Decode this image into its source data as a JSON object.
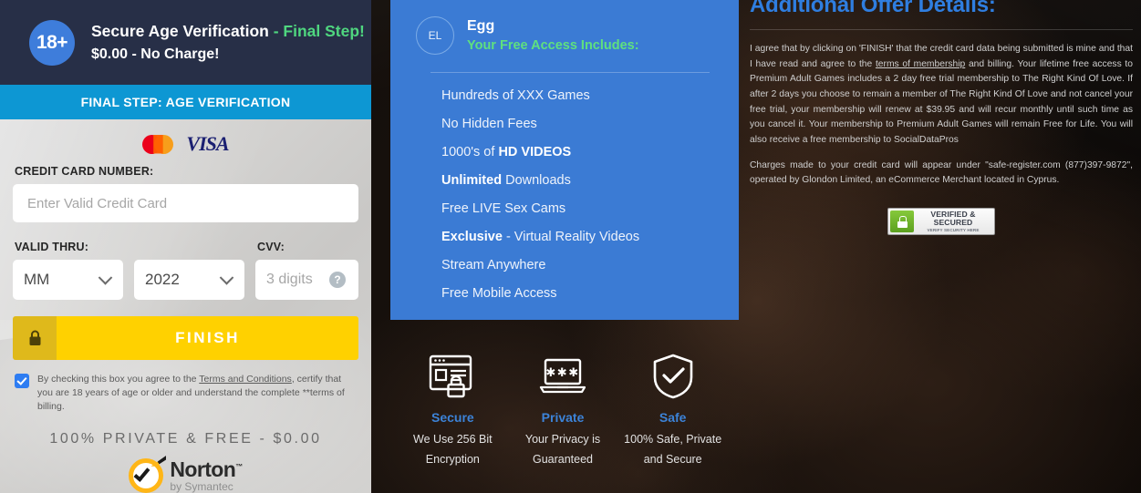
{
  "left_panel": {
    "badge": "18+",
    "title_main": "Secure Age Verification",
    "title_accent": "- Final Step!",
    "subtitle": "$0.00 - No Charge!",
    "step_bar": "FINAL STEP: AGE VERIFICATION",
    "card_logos": [
      "mastercard-logo",
      "visa-logo"
    ],
    "visa_text": "VISA",
    "credit_card_label": "CREDIT CARD NUMBER:",
    "credit_card_placeholder": "Enter Valid Credit Card",
    "credit_card_value": "",
    "valid_thru_label": "VALID THRU:",
    "month_value": "MM",
    "year_value": "2022",
    "cvv_label": "CVV:",
    "cvv_placeholder": "3 digits",
    "cvv_value": "",
    "cvv_help_glyph": "?",
    "finish_label": "FINISH",
    "agree_text_1": "By checking this box you agree to the ",
    "agree_link": "Terms and Conditions",
    "agree_text_2": ", certify that you are 18 years of age or older and understand the complete **terms of billing.",
    "checkbox_checked": true,
    "private_line": "100% PRIVATE & FREE - $0.00",
    "norton_name": "Norton",
    "norton_tm": "™",
    "norton_by": "by Symantec"
  },
  "offer_card": {
    "avatar_initials": "EL",
    "name": "Egg",
    "tagline": "Your Free Access Includes:",
    "items": [
      {
        "plain": "Hundreds of XXX Games",
        "bold": "",
        "bold_first": false
      },
      {
        "plain": "No Hidden Fees",
        "bold": "",
        "bold_first": false
      },
      {
        "plain": "1000's of ",
        "bold": "HD VIDEOS",
        "bold_first": false
      },
      {
        "plain": " Downloads",
        "bold": "Unlimited",
        "bold_first": true
      },
      {
        "plain": "Free LIVE Sex Cams",
        "bold": "",
        "bold_first": false
      },
      {
        "plain": " - Virtual Reality Videos",
        "bold": "Exclusive",
        "bold_first": true
      },
      {
        "plain": "Stream Anywhere",
        "bold": "",
        "bold_first": false
      },
      {
        "plain": "Free Mobile Access",
        "bold": "",
        "bold_first": false
      }
    ]
  },
  "trust_badges": [
    {
      "icon": "browser-lock-icon",
      "title": "Secure",
      "desc": "We Use 256 Bit Encryption"
    },
    {
      "icon": "laptop-password-icon",
      "title": "Private",
      "desc": "Your Privacy is Guaranteed"
    },
    {
      "icon": "shield-check-icon",
      "title": "Safe",
      "desc": "100% Safe, Private and Secure"
    }
  ],
  "offer_details": {
    "title": "Additional Offer Details:",
    "para1_a": "I agree that by clicking on 'FINISH' that the credit card data being submitted is mine and that I have read and agree to the ",
    "para1_link": "terms of membership",
    "para1_b": " and billing. Your lifetime free access to Premium Adult Games includes a 2 day free trial membership to The Right Kind Of Love. If after 2 days you choose to remain a member of The Right Kind Of Love and not cancel your free trial, your membership will renew at $39.95 and will recur monthly until such time as you cancel it. Your membership to Premium Adult Games will remain Free for Life. You will also receive a free membership to SocialDataPros",
    "para2": "Charges made to your credit card will appear under \"safe-register.com (877)397-9872\", operated by Glondon Limited, an eCommerce Merchant located in Cyprus.",
    "verified_title": "VERIFIED & SECURED",
    "verified_sub": "VERIFY SECURITY HERE"
  },
  "colors": {
    "header_navy": "#272f47",
    "step_blue": "#0d97d3",
    "accent_green": "#4fd67f",
    "offer_blue": "#3b7bd4",
    "finish_yellow": "#ffd100",
    "link_blue": "#2f7ee0"
  }
}
